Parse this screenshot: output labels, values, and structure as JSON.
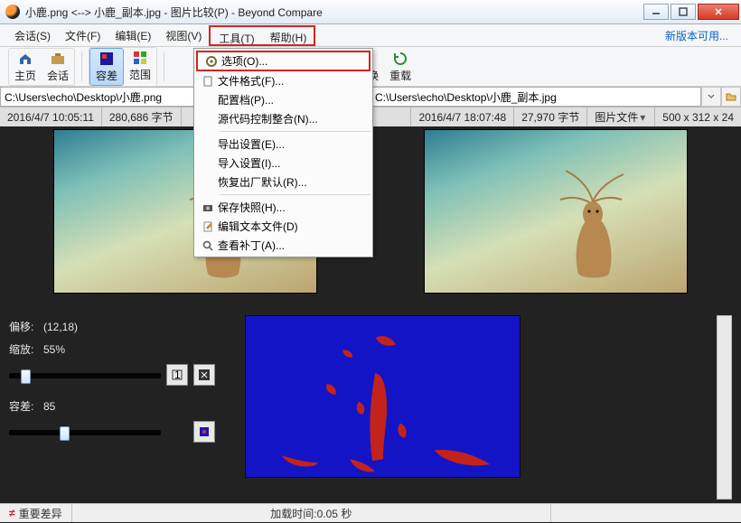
{
  "title": "小鹿.png <--> 小鹿_副本.jpg - 图片比较(P) - Beyond Compare",
  "menubar": {
    "session": "会话(S)",
    "file": "文件(F)",
    "edit": "编辑(E)",
    "view": "视图(V)",
    "tools": "工具(T)",
    "help": "帮助(H)",
    "update_link": "新版本可用..."
  },
  "tools_menu": {
    "options": "选项(O)...",
    "file_formats": "文件格式(F)...",
    "profiles": "配置档(P)...",
    "source_control": "源代码控制整合(N)...",
    "export_settings": "导出设置(E)...",
    "import_settings": "导入设置(I)...",
    "restore_defaults": "恢复出厂默认(R)...",
    "save_snapshot": "保存快照(H)...",
    "edit_text_file": "编辑文本文件(D)",
    "view_patch": "查看补丁(A)..."
  },
  "toolbar": {
    "home": "主页",
    "sessions": "会话",
    "diff": "容差",
    "range": "范围",
    "swap": "交换",
    "reload": "重载"
  },
  "paths": {
    "left": "C:\\Users\\echo\\Desktop\\小鹿.png",
    "right": "C:\\Users\\echo\\Desktop\\小鹿_副本.jpg"
  },
  "info": {
    "left_time": "2016/4/7 10:05:11",
    "left_size": "280,686 字节",
    "right_time": "2016/4/7 18:07:48",
    "right_size": "27,970 字节",
    "right_type": "图片文件",
    "right_dim": "500 x 312 x 24"
  },
  "controls": {
    "offset_label": "偏移:",
    "offset_value": "(12,18)",
    "zoom_label": "缩放:",
    "zoom_value": "55%",
    "tolerance_label": "容差:",
    "tolerance_value": "85"
  },
  "status": {
    "major_diff": "重要差异",
    "load_time_label": "加载时间: ",
    "load_time_value": "0.05 秒"
  }
}
